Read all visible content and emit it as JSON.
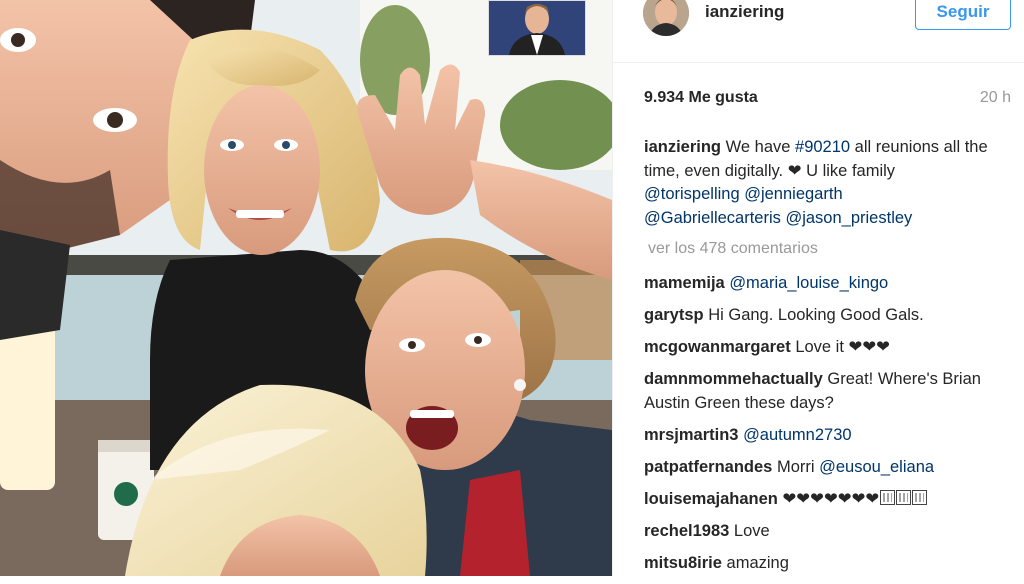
{
  "post": {
    "username": "ianziering",
    "follow_label": "Seguir",
    "likes": "9.934 Me gusta",
    "time_ago": "20 h",
    "caption": {
      "text1": "We have ",
      "hashtag": "#90210",
      "text2": " all reunions all the time, even digitally. ",
      "heart": "❤",
      "text3": " U like family ",
      "mentions": [
        "@torispelling",
        "@jenniegarth",
        "@Gabriellecarteris",
        "@jason_priestley"
      ]
    },
    "view_comments": "ver los 478 comentarios"
  },
  "comments": [
    {
      "user": "mamemija",
      "text": "",
      "mention": "@maria_louise_kingo"
    },
    {
      "user": "garytsp",
      "text": "Hi Gang. Looking Good Gals.",
      "mention": ""
    },
    {
      "user": "mcgowanmargaret",
      "text": "Love it ❤❤❤",
      "mention": ""
    },
    {
      "user": "damnmommehactually",
      "text": "Great! Where's Brian Austin Green these days?",
      "mention": ""
    },
    {
      "user": "mrsjmartin3",
      "text": "",
      "mention": "@autumn2730"
    },
    {
      "user": "patpatfernandes",
      "text": "Morri ",
      "mention": "@eusou_eliana"
    },
    {
      "user": "louisemajahanen",
      "text": "❤❤❤❤❤❤❤",
      "mention": ""
    },
    {
      "user": "rechel1983",
      "text": "Love",
      "mention": ""
    },
    {
      "user": "mitsu8irie",
      "text": "amazing",
      "mention": ""
    }
  ],
  "colors": {
    "link": "#003569",
    "accent": "#3897f0",
    "muted": "#999999",
    "text": "#262626"
  }
}
